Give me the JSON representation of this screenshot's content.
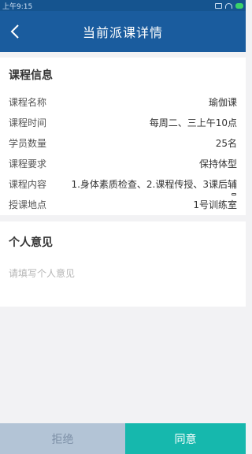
{
  "status_bar": {
    "time": "上午9:15"
  },
  "header": {
    "title": "当前派课详情",
    "back_icon": "chevron-left-icon"
  },
  "course_info": {
    "title": "课程信息",
    "rows": [
      {
        "label": "课程名称",
        "value": "瑜伽课"
      },
      {
        "label": "课程时间",
        "value": "每周二、三上午10点"
      },
      {
        "label": "学员数量",
        "value": "25名"
      },
      {
        "label": "课程要求",
        "value": "保持体型"
      },
      {
        "label": "课程内容",
        "value": "1.身体素质检查、2.课程传授、3课后辅"
      },
      {
        "label": "授课地点",
        "value": "1号训练室"
      }
    ]
  },
  "opinion": {
    "title": "个人意见",
    "placeholder": "请填写个人意见",
    "value": ""
  },
  "actions": {
    "reject_label": "拒绝",
    "agree_label": "同意"
  },
  "colors": {
    "nav": "#1a5c9e",
    "agree": "#16b8ad",
    "reject": "#b3c4d6"
  }
}
